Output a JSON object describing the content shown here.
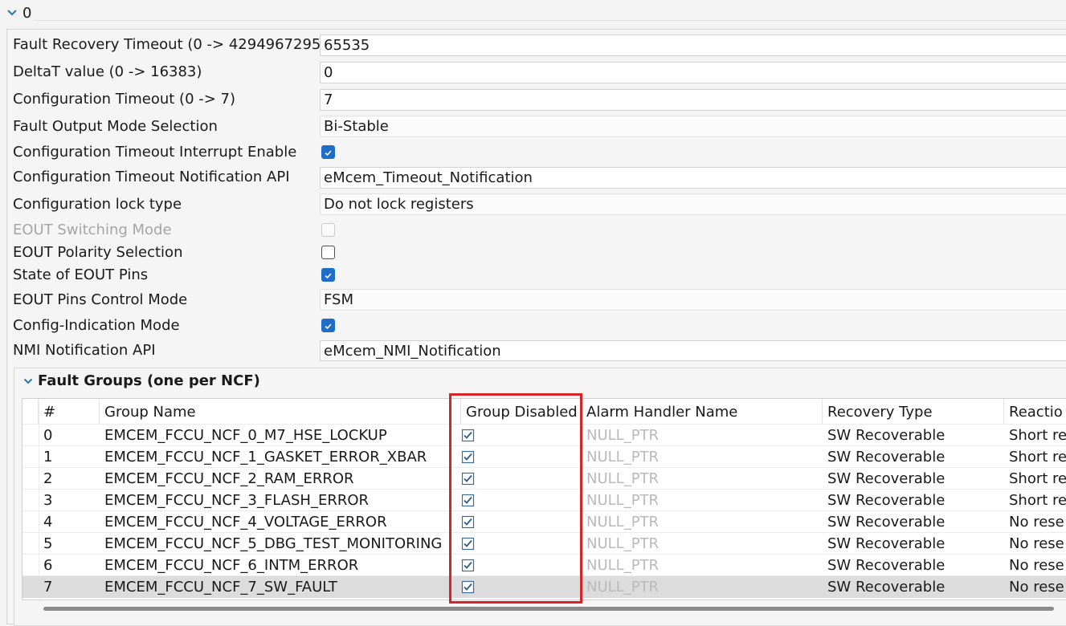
{
  "node": {
    "title": "0"
  },
  "properties": [
    {
      "label": "Fault Recovery Timeout (0 -> 4294967295)",
      "kind": "text",
      "value": "65535",
      "enabled": true
    },
    {
      "label": "DeltaT value (0 -> 16383)",
      "kind": "text",
      "value": "0",
      "enabled": true
    },
    {
      "label": "Configuration Timeout (0 -> 7)",
      "kind": "text",
      "value": "7",
      "enabled": true
    },
    {
      "label": "Fault Output Mode Selection",
      "kind": "select",
      "value": "Bi-Stable",
      "enabled": true
    },
    {
      "label": "Configuration Timeout Interrupt Enable",
      "kind": "checkbox",
      "checked": true,
      "enabled": true
    },
    {
      "label": "Configuration Timeout Notification API",
      "kind": "text",
      "value": "eMcem_Timeout_Notification",
      "enabled": true
    },
    {
      "label": "Configuration lock type",
      "kind": "select",
      "value": "Do not lock registers",
      "enabled": true
    },
    {
      "label": "EOUT Switching Mode",
      "kind": "checkbox",
      "checked": false,
      "enabled": false
    },
    {
      "label": "EOUT Polarity Selection",
      "kind": "checkbox",
      "checked": false,
      "enabled": true
    },
    {
      "label": "State of EOUT Pins",
      "kind": "checkbox",
      "checked": true,
      "enabled": true
    },
    {
      "label": "EOUT Pins Control Mode",
      "kind": "select",
      "value": "FSM",
      "enabled": true
    },
    {
      "label": "Config-Indication Mode",
      "kind": "checkbox",
      "checked": true,
      "enabled": true
    },
    {
      "label": "NMI Notification API",
      "kind": "text",
      "value": "eMcem_NMI_Notification",
      "enabled": true
    }
  ],
  "fault_groups": {
    "title": "Fault Groups (one per NCF)",
    "columns": [
      "#",
      "Group Name",
      "Group Disabled",
      "Alarm Handler Name",
      "Recovery Type",
      "Reactio"
    ],
    "rows": [
      {
        "index": "0",
        "name": "EMCEM_FCCU_NCF_0_M7_HSE_LOCKUP",
        "disabled": true,
        "handler": "NULL_PTR",
        "recovery": "SW Recoverable",
        "reaction": "Short re"
      },
      {
        "index": "1",
        "name": "EMCEM_FCCU_NCF_1_GASKET_ERROR_XBAR",
        "disabled": true,
        "handler": "NULL_PTR",
        "recovery": "SW Recoverable",
        "reaction": "Short re"
      },
      {
        "index": "2",
        "name": "EMCEM_FCCU_NCF_2_RAM_ERROR",
        "disabled": true,
        "handler": "NULL_PTR",
        "recovery": "SW Recoverable",
        "reaction": "Short re"
      },
      {
        "index": "3",
        "name": "EMCEM_FCCU_NCF_3_FLASH_ERROR",
        "disabled": true,
        "handler": "NULL_PTR",
        "recovery": "SW Recoverable",
        "reaction": "Short re"
      },
      {
        "index": "4",
        "name": "EMCEM_FCCU_NCF_4_VOLTAGE_ERROR",
        "disabled": true,
        "handler": "NULL_PTR",
        "recovery": "SW Recoverable",
        "reaction": "No rese"
      },
      {
        "index": "5",
        "name": "EMCEM_FCCU_NCF_5_DBG_TEST_MONITORING",
        "disabled": true,
        "handler": "NULL_PTR",
        "recovery": "SW Recoverable",
        "reaction": "No rese"
      },
      {
        "index": "6",
        "name": "EMCEM_FCCU_NCF_6_INTM_ERROR",
        "disabled": true,
        "handler": "NULL_PTR",
        "recovery": "SW Recoverable",
        "reaction": "No rese"
      },
      {
        "index": "7",
        "name": "EMCEM_FCCU_NCF_7_SW_FAULT",
        "disabled": true,
        "handler": "NULL_PTR",
        "recovery": "SW Recoverable",
        "reaction": "No rese",
        "selected": true
      }
    ]
  },
  "colors": {
    "accent": "#1e6ec8",
    "highlight": "#d9232b",
    "selected_row": "#dcdcdc"
  }
}
